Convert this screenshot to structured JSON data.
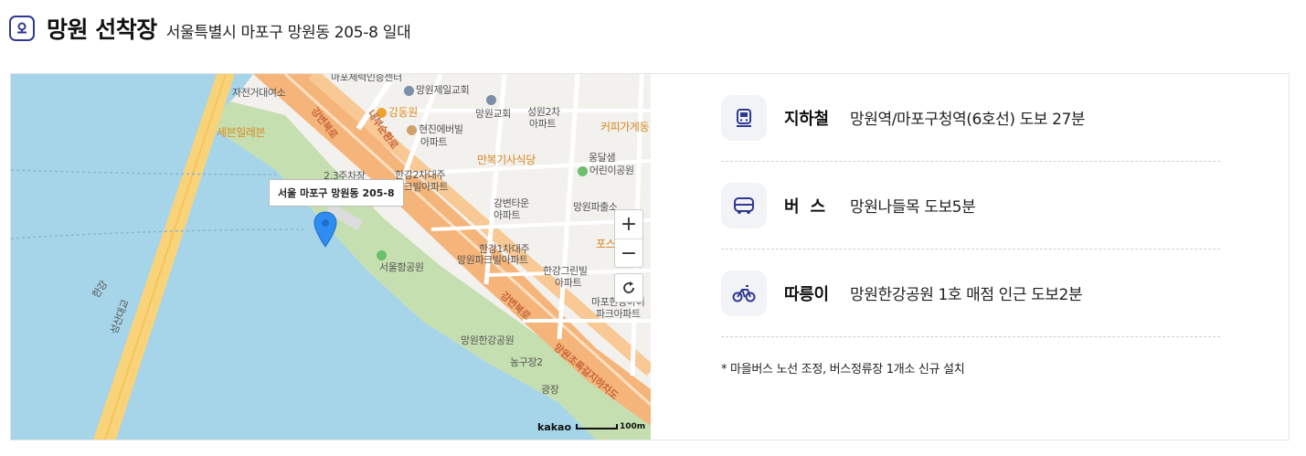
{
  "header": {
    "title": "망원 선착장",
    "address": "서울특별시 마포구 망원동 205-8 일대",
    "icon": "location-badge-icon"
  },
  "map": {
    "popup_address": "서울 마포구 망원동 205-8",
    "labels": {
      "fitness_center": "마포체력인증센터",
      "jeolgyo": "망원제일교회",
      "jajeon": "자전거대여소",
      "gangdong": "강동원",
      "hyunjin": "현진에버빌",
      "apt1": "아파트",
      "mangwon_church": "망원교회",
      "seongwon": "성원2차",
      "apt2": "아파트",
      "coffee": "커피가게동",
      "sebit": "세븐일레븐",
      "parking": "2.3주차장",
      "gangbyeon_road": "강변북로",
      "naebu_road": "내부순환로",
      "hangang2": "한강2차대주",
      "parkbill": "파크빌아파트",
      "manbok": "만복기사식당",
      "ongdal": "옹달샘",
      "kindergarten": "어린이공원",
      "gangbyeon_town": "강변타운",
      "apt3": "아파트",
      "police": "망원파출소",
      "hangang1": "한강1차대주",
      "mangwon_park_bill": "망원파크빌아파트",
      "posco": "포스",
      "hangang_green": "한강그린빌",
      "apt4": "아파트",
      "seoul_ship": "서울함공원",
      "mapo_hangang": "마포한강아이",
      "parkapt": "파크아파트",
      "seongsan_bridge": "성산대교",
      "hangang_label": "한강",
      "mangwon_hangang": "망원한강공원",
      "gangbyeon_road2": "강변북로",
      "underpass": "망원초록길지하차도",
      "basketball": "농구장2",
      "plaza": "광장"
    },
    "zoom_in": "+",
    "zoom_out": "−",
    "brand": "kakao",
    "scale": "100m",
    "colors": {
      "water": "#a6d4e8",
      "park": "#c6dfb0",
      "highway": "#f5b57a",
      "road": "#ffffff",
      "bridge": "#f8d37a",
      "pin": "#2f8cf0"
    }
  },
  "transport": [
    {
      "icon": "subway-icon",
      "title": "지하철",
      "text": "망원역/마포구청역(6호선) 도보 27분"
    },
    {
      "icon": "bus-icon",
      "title": "버스",
      "text": "망원나들목 도보5분"
    },
    {
      "icon": "bicycle-icon",
      "title": "따릉이",
      "text": "망원한강공원 1호 매점 인근 도보2분"
    }
  ],
  "note": "* 마을버스 노선 조정, 버스정류장 1개소 신규 설치",
  "accent_color": "#2f3a8f"
}
